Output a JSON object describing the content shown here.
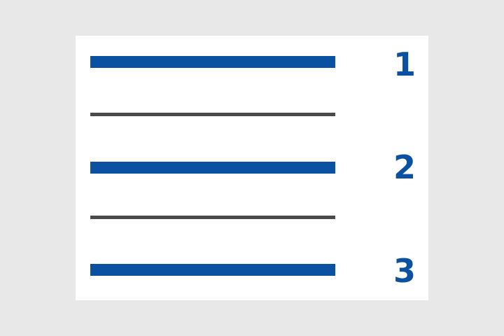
{
  "items": [
    {
      "number": "1"
    },
    {
      "number": "2"
    },
    {
      "number": "3"
    }
  ],
  "colors": {
    "background": "#e8e8e8",
    "card": "#ffffff",
    "accent": "#0a52a1",
    "divider": "#4a4a4a"
  }
}
